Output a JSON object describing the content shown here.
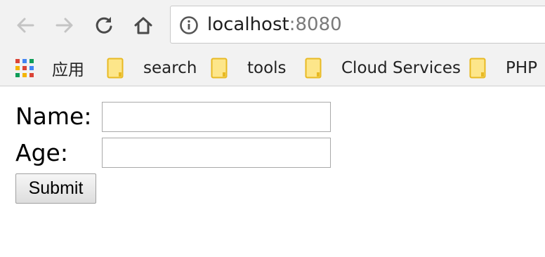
{
  "address_bar": {
    "host": "localhost",
    "port": ":8080"
  },
  "bookmarks": {
    "apps_label": "应用",
    "items": [
      {
        "label": "search",
        "icon": "folder-icon"
      },
      {
        "label": "tools",
        "icon": "folder-icon"
      },
      {
        "label": "Cloud Services",
        "icon": "folder-icon"
      },
      {
        "label": "PHP",
        "icon": "folder-icon"
      }
    ]
  },
  "form": {
    "name_label": "Name:",
    "name_value": "",
    "age_label": "Age:",
    "age_value": "",
    "submit_label": "Submit"
  },
  "colors": {
    "toolbar_bg": "#f2f2f2",
    "folder_fill": "#fde68a",
    "folder_stroke": "#e8b923",
    "apps_grid": [
      "#db4437",
      "#4285f4",
      "#0f9d58",
      "#f4b400",
      "#db4437",
      "#4285f4",
      "#0f9d58",
      "#f4b400",
      "#db4437"
    ]
  }
}
